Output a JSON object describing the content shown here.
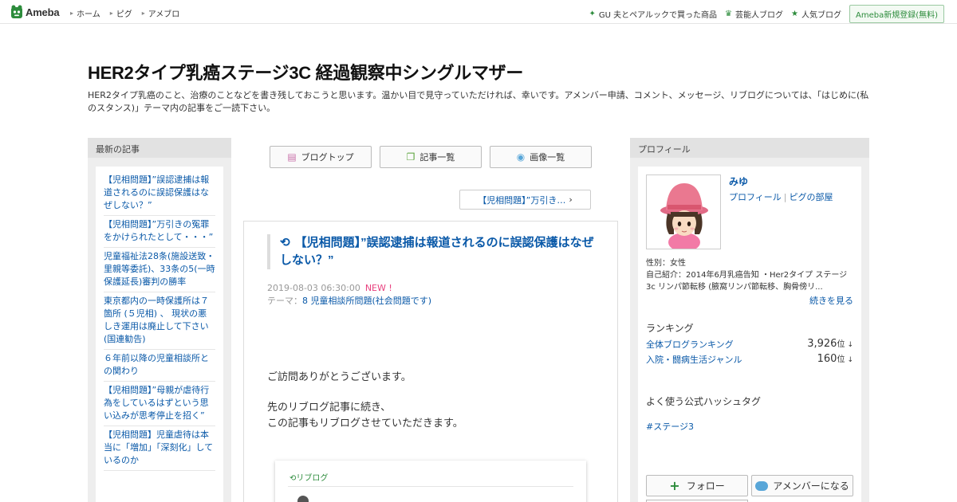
{
  "header": {
    "logo_text": "Ameba",
    "nav": [
      "ホーム",
      "ピグ",
      "アメブロ"
    ],
    "right_links": [
      {
        "label": "GU 夫とペアルックで買った商品",
        "icon": "sparkle-icon"
      },
      {
        "label": "芸能人ブログ",
        "icon": "crown-icon"
      },
      {
        "label": "人気ブログ",
        "icon": "star-icon"
      }
    ],
    "signup_label": "Ameba新規登録(無料)"
  },
  "blog": {
    "title": "HER2タイプ乳癌ステージ3C 経過観察中シングルマザー",
    "description": "HER2タイプ乳癌のこと、治療のことなどを書き残しておこうと思います。温かい目で見守っていただければ、幸いです。アメンバー申請、コメント、メッセージ、リブログについては、「はじめに(私のスタンス)」テーマ内の記事をご一読下さい。"
  },
  "left": {
    "heading": "最新の記事",
    "items": [
      "【児相問題】”誤認逮捕は報道されるのに誤認保護はなぜしない？”",
      "【児相問題】”万引きの冤罪をかけられたとして・・・”",
      "児童福祉法28条(施設送致・里親等委託)、33条の5(一時保護延長)審判の勝率",
      "東京都内の一時保護所は７箇所 (５児相) 、 現状の悪しき運用は廃止して下さい(国連勧告)",
      "６年前以降の児童相談所との関わり",
      "【児相問題】”母親が虐待行為をしているはずという思い込みが思考停止を招く”",
      "【児相問題】児童虐待は本当に「増加」「深刻化」しているのか"
    ]
  },
  "tabs": [
    {
      "label": "ブログトップ",
      "icon": "document-icon"
    },
    {
      "label": "記事一覧",
      "icon": "copy-icon"
    },
    {
      "label": "画像一覧",
      "icon": "camera-icon"
    }
  ],
  "next_article": "【児相問題】”万引き…",
  "article": {
    "title": "【児相問題】”誤認逮捕は報道されるのに誤認保護はなぜしない？”",
    "date": "2019-08-03 06:30:00",
    "new_badge": "NEW !",
    "theme_prefix": "テーマ：",
    "theme": "8 児童相談所問題(社会問題です)",
    "body": [
      "ご訪問ありがとうございます。",
      "先のリブログ記事に続き、",
      "この記事もリブログさせていただきます。"
    ],
    "reblog_label": "リブログ"
  },
  "profile": {
    "heading": "プロフィール",
    "name": "みゆ",
    "link_profile": "プロフィール",
    "link_room": "ピグの部屋",
    "sex": "性別：女性",
    "intro": "自己紹介：2014年6月乳癌告知 ・Her2タイプ ステージ3c リンパ節転移 (腋窩リンパ節転移、胸骨傍リ...",
    "more": "続きを見る",
    "ranking_heading": "ランキング",
    "rankings": [
      {
        "label": "全体ブログランキング",
        "value": "3,926",
        "unit": "位",
        "arrow": "↓"
      },
      {
        "label": "入院・闘病生活ジャンル",
        "value": "160",
        "unit": "位",
        "arrow": "↓"
      }
    ],
    "hashtag_heading": "よく使う公式ハッシュタグ",
    "hashtag": "#ステージ3",
    "follow_label": "フォロー",
    "member_label": "アメンバーになる"
  },
  "colors": {
    "link": "#0a59a8",
    "brand_green": "#2d8c3c",
    "new_pink": "#e8407e"
  }
}
